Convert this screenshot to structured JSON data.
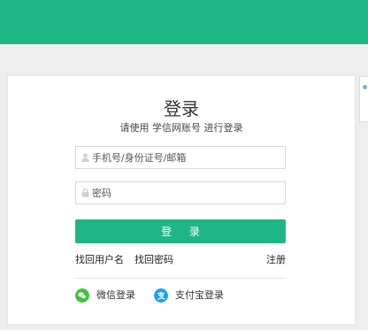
{
  "colors": {
    "brand": "#1fb685",
    "wechat": "#3ec13b",
    "alipay": "#1aa3e8"
  },
  "login": {
    "title": "登录",
    "subtitle": "请使用 学信网账号 进行登录",
    "username_placeholder": "手机号/身份证号/邮箱",
    "password_placeholder": "密码",
    "submit_label": "登 录",
    "forgot_username": "找回用户名",
    "forgot_password": "找回密码",
    "register": "注册",
    "wechat_login": "微信登录",
    "alipay_login": "支付宝登录"
  },
  "icons": {
    "username": "user-icon",
    "password": "lock-icon",
    "wechat": "wechat-icon",
    "alipay": "alipay-icon"
  }
}
